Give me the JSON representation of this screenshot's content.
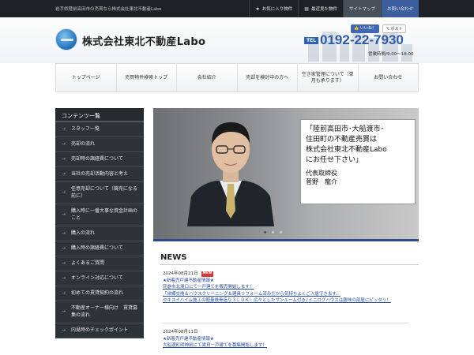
{
  "topbar": {
    "tagline": "岩手県陸前高田市の売買なら株式会社東北不動産Labo",
    "favorites": "お気に入り物件",
    "recent": "最近見た物件",
    "sitemap": "サイトマップ",
    "contact": "お問い合わせ"
  },
  "header": {
    "company": "株式会社東北不動産Labo",
    "fb_like": "いいね！",
    "tweet": "ポスト",
    "tel_label": "TEL",
    "tel": "0192-22-7930",
    "hours": "営業時間/9:00〜18:00"
  },
  "nav": [
    "トップページ",
    "売買物件検索トップ",
    "会社紹介",
    "売却を検討中の方へ",
    "空き家管理について（単月も承ります）",
    "お問い合わせ"
  ],
  "sidebar": {
    "title": "コンテンツ一覧",
    "items": [
      "スタッフ一覧",
      "売却の流れ",
      "売却時の諸経費について",
      "当社の売却活動内容と考え",
      "任意売却について（競売になる前に）",
      "購入時に一番大事な資金計画のこと",
      "購入の流れ",
      "購入時の諸経費について",
      "よくあるご質問",
      "オンライン対応について",
      "初めての賃貸契約の流れ",
      "不動産オーナー様向け　賃貸募集の流れ",
      "内見時のチェックポイント"
    ]
  },
  "slider": {
    "quote": "「陸前高田市･大船渡市･\n住田町の不動産売買は\n株式会社東北不動産Labo\nにお任せ下さい」",
    "signature": "代表取締役\n菅野　龍介"
  },
  "news": {
    "title": "NEWS",
    "new_badge": "NEW",
    "items": [
      {
        "date": "2024年08月21日",
        "head": "★新着売戸建不動産情報★",
        "lines": [
          "花巻市北湯口にて一戸建てを販売開始します！",
          "「帰郷交換＆ハウスクリーニング＆建具リフォーム済みだから気持ちよくご入居できます。",
          "セキスイハイム施工の軽量鉄骨造り３ＬＤＫ！広々としたサンルーム付き♪ミニログハウスは趣味の部屋にピッタリ！"
        ]
      },
      {
        "date": "2024年08月11日",
        "head": "★新着売戸建不動産情報★",
        "lines": [
          "大船渡町明神前にて賃貸一戸建てを募集開始します！"
        ]
      }
    ]
  }
}
